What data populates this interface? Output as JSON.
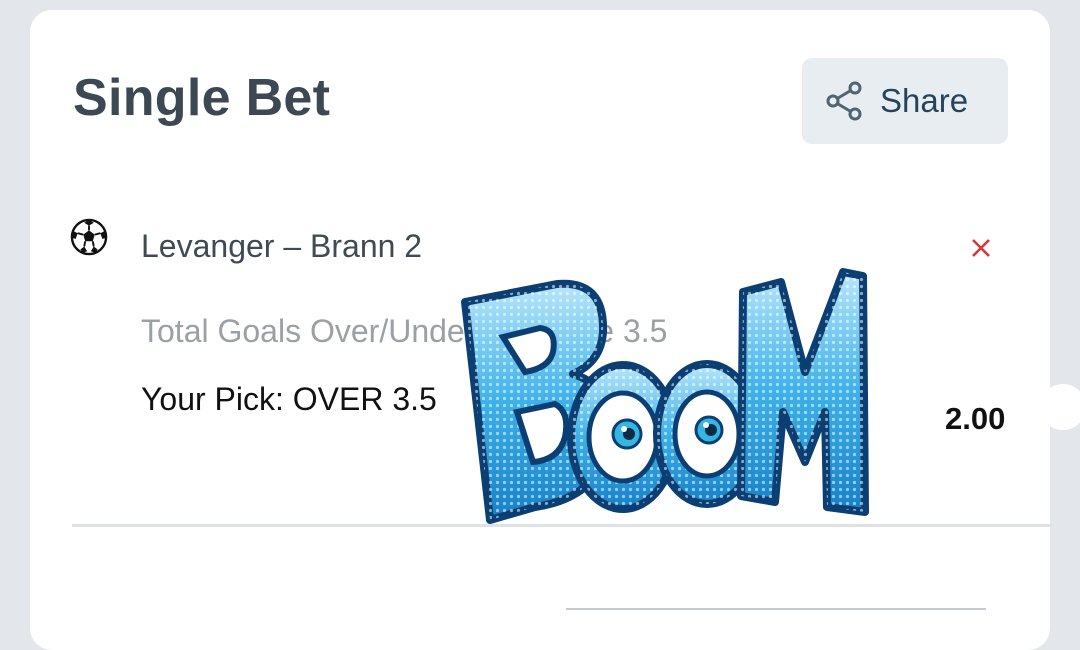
{
  "header": {
    "title": "Single Bet",
    "share_label": "Share"
  },
  "bet": {
    "sport_icon": "soccer-ball-icon",
    "match": "Levanger – Brann 2",
    "market": "Total Goals Over/Under Full Time 3.5",
    "pick": "Your Pick: OVER 3.5",
    "odds": "2.00",
    "remove_icon": "close-icon"
  },
  "overlay": {
    "sticker_text": "BOOM"
  },
  "colors": {
    "title": "#3c4852",
    "share_bg": "#e8edf1",
    "share_text": "#24445c",
    "remove": "#d23a3a",
    "market_text": "#9aa0a5",
    "boom_blue": "#2aa3e0"
  }
}
